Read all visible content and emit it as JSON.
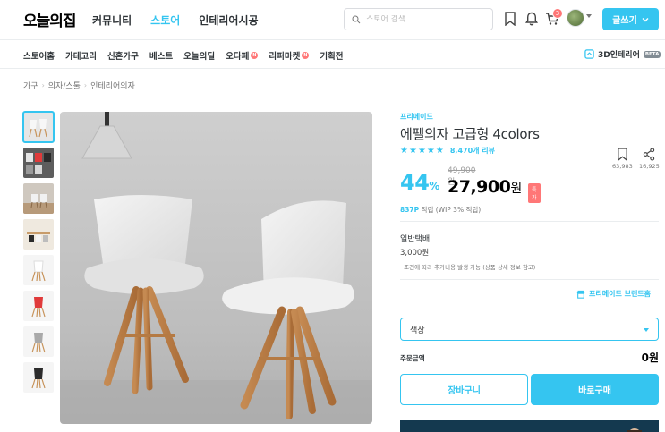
{
  "header": {
    "logo": "오늘의집",
    "nav": [
      "커뮤니티",
      "스토어",
      "인테리어시공"
    ],
    "active_nav": "스토어",
    "search_placeholder": "스토어 검색",
    "cart_count": "3",
    "write_label": "글쓰기"
  },
  "subnav": {
    "items": [
      "스토어홈",
      "카테고리",
      "신혼가구",
      "베스트",
      "오늘의딜",
      "오다페",
      "리퍼마켓",
      "기획전"
    ],
    "badge_letter": "N",
    "three_d_label": "3D인테리어",
    "three_d_badge": "BETA"
  },
  "breadcrumb": [
    "가구",
    "의자/스툴",
    "인테리어의자"
  ],
  "product": {
    "brand": "프리메이드",
    "title": "에펠의자 고급형 4colors",
    "review_count": "8,470개 리뷰",
    "rating": 4.5,
    "scrap_count": "63,983",
    "share_count": "16,925",
    "discount": "44",
    "discount_unit": "%",
    "original_price": "49,900원",
    "price": "27,900",
    "price_unit": "원",
    "special_badge": "특가",
    "points_value": "837P",
    "points_text": " 적립 (WIP 3% 적립)"
  },
  "shipping": {
    "title": "일반택배",
    "price": "3,000원",
    "note": "· 조건에 따라 추가비용 발생 가능 (상품 상세 정보 참고)"
  },
  "brand_home": "프리메이드 브랜드홈",
  "option": {
    "label": "색상"
  },
  "order": {
    "total_label": "주문금액",
    "total_value": "0원",
    "cart_button": "장바구니",
    "buy_button": "바로구매"
  },
  "colors": {
    "accent": "#35c5f0",
    "badge": "#ff7777"
  }
}
